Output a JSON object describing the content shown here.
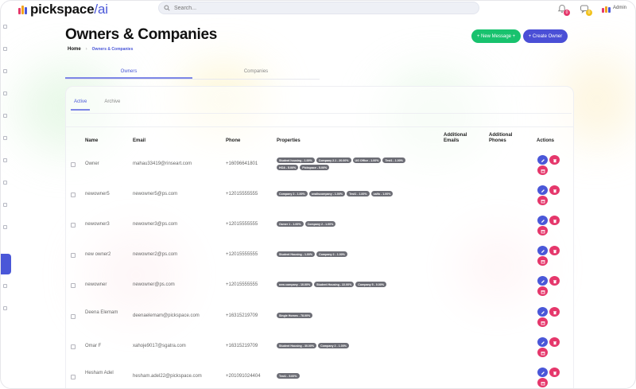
{
  "brand": {
    "name": "pickspace",
    "separator": "/",
    "suffix": "ai",
    "mark_colors": [
      "#e5376b",
      "#f2a21c",
      "#4a57d8"
    ]
  },
  "search": {
    "placeholder": "Search..."
  },
  "topbar": {
    "notif_count": "0",
    "msg_count": "0",
    "user_label": "Admin"
  },
  "header": {
    "title": "Owners & Companies",
    "breadcrumb": {
      "home": "Home",
      "separator": "›",
      "current": "Owners & Companies"
    },
    "new_message_label": "+ New Message +",
    "create_owner_label": "+ Create Owner"
  },
  "tabs": {
    "owners": "Owners",
    "companies": "Companies"
  },
  "subtabs": {
    "active": "Active",
    "archive": "Archive"
  },
  "columns": {
    "name": "Name",
    "email": "Email",
    "phone": "Phone",
    "properties": "Properties",
    "additional_emails": "Additional Emails",
    "additional_phones": "Additional Phones",
    "actions": "Actions"
  },
  "rows": [
    {
      "name": "Owner",
      "email": "mahau33419@rinseart.com",
      "phone": "+16096641801",
      "properties": [
        "Student housing - 1.00%",
        "Company 2.1 - 20.00%",
        "UG Office - 1.00%",
        "Test1 - 1.00%",
        "HOA - 5.00%",
        "Pickspace - 5.00%"
      ]
    },
    {
      "name": "newowner5",
      "email": "newowner5@ps.com",
      "phone": "+12015555555",
      "properties": [
        "Company 2 - 1.00%",
        "ovaliscompany - 1.00%",
        "Test1 - 1.00%",
        "caifo - 1.00%"
      ]
    },
    {
      "name": "newowner3",
      "email": "newowner3@ps.com",
      "phone": "+12015555555",
      "properties": [
        "Owner 1 - 1.00%",
        "Company 2 - 1.00%"
      ]
    },
    {
      "name": "new owner2",
      "email": "newowner2@ps.com",
      "phone": "+12015555555",
      "properties": [
        "Student Housing - 1.00%",
        "Company 2 - 1.00%"
      ]
    },
    {
      "name": "newowner",
      "email": "newowner@ps.com",
      "phone": "+12015555555",
      "properties": [
        "new company - 10.00%",
        "Student Housing - 22.00%",
        "Company 5 - 0.00%"
      ]
    },
    {
      "name": "Deena Elemam",
      "email": "deenaelemam@pickspace.com",
      "phone": "+16315219709",
      "properties": [
        "Single Homes - 78.00%"
      ]
    },
    {
      "name": "Omar F",
      "email": "xahoje9017@sgatra.com",
      "phone": "+16315219709",
      "properties": [
        "Student Housing - 30.00%",
        "Company 2 - 1.00%"
      ]
    },
    {
      "name": "Hesham Adel",
      "email": "hesham.adel22@pickspace.com",
      "phone": "+201091024404",
      "properties": [
        "Test1 - 5.00%"
      ]
    }
  ]
}
